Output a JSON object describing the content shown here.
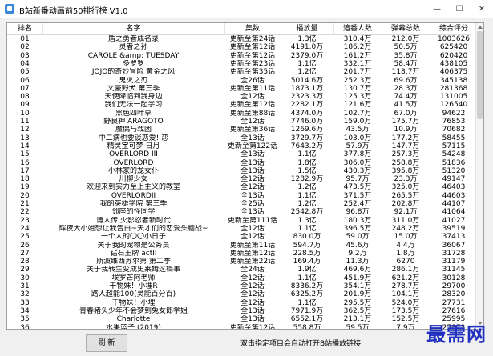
{
  "window": {
    "title": "B站新番动画前50排行榜 V1.0",
    "minimize": "—",
    "maximize": "☐",
    "close": "✕"
  },
  "table": {
    "headers": [
      "排名",
      "名字",
      "集数",
      "播放量",
      "追番人数",
      "弹幕总数",
      "综合评分"
    ],
    "rows": [
      [
        "01",
        "盾之勇者成名录",
        "更新至第24话",
        "1.3亿",
        "310.4万",
        "212.0万",
        "1003626"
      ],
      [
        "02",
        "灵者之孙",
        "更新至第12话",
        "4191.0万",
        "186.2万",
        "50.5万",
        "625420"
      ],
      [
        "03",
        "CAROLE &amp; TUESDAY",
        "更新至第12话",
        "2379.0万",
        "161.2万",
        "35.8万",
        "620420"
      ],
      [
        "04",
        "多罗罗",
        "更新至第23话",
        "1.1亿",
        "332.1万",
        "58.4万",
        "438105"
      ],
      [
        "05",
        "JOJO的奇妙冒险 黄金之风",
        "更新至第35话",
        "1.2亿",
        "201.7万",
        "118.7万",
        "406375"
      ],
      [
        "06",
        "鬼灭之刃",
        "全26话",
        "5014.6万",
        "252.3万",
        "69.6万",
        "345138"
      ],
      [
        "07",
        "文豪野犬 第三季",
        "更新至第11话",
        "1873.1万",
        "130.7万",
        "28.3万",
        "281368"
      ],
      [
        "08",
        "天使降临到我身边",
        "全12话",
        "2323.3万",
        "125.3万",
        "74.4万",
        "131005"
      ],
      [
        "09",
        "我们无法一起学习",
        "更新至第12话",
        "2282.1万",
        "121.6万",
        "41.5万",
        "126540"
      ],
      [
        "10",
        "黑色四叶草",
        "更新至第88话",
        "4374.0万",
        "102.7万",
        "67.0万",
        "94622"
      ],
      [
        "11",
        "野良神 ARAGOTO",
        "全12话",
        "7746.0万",
        "159.0万",
        "175.7万",
        "76853"
      ],
      [
        "12",
        "魔偶马戏团",
        "更新至第36话",
        "1269.6万",
        "43.5万",
        "10.9万",
        "70682"
      ],
      [
        "13",
        "中二病也要谈恋爱! 恋",
        "全13话",
        "3729.7万",
        "103.0万",
        "177.2万",
        "58455"
      ],
      [
        "14",
        "精灵宝可梦 日月",
        "更新至第122话",
        "7643.2万",
        "57.9万",
        "147.7万",
        "57115"
      ],
      [
        "15",
        "OVERLORD III",
        "全13话",
        "1.1亿",
        "377.8万",
        "257.3万",
        "54248"
      ],
      [
        "16",
        "OVERLORD",
        "全13话",
        "1.8亿",
        "306.0万",
        "258.8万",
        "51836"
      ],
      [
        "17",
        "小林家的龙女仆",
        "全13话",
        "1.5亿",
        "430.3万",
        "395.8万",
        "51320"
      ],
      [
        "18",
        "川柳少女",
        "全12话",
        "1282.9万",
        "95.7万",
        "23.3万",
        "49147"
      ],
      [
        "19",
        "欢迎来到实力至上主义的教室",
        "全12话",
        "1.2亿",
        "473.5万",
        "325.0万",
        "46403"
      ],
      [
        "20",
        "OVERLORDII",
        "全13话",
        "1.1亿",
        "371.5万",
        "265.5万",
        "44603"
      ],
      [
        "21",
        "我的英雄学院 第三季",
        "全25话",
        "1.2亿",
        "252.4万",
        "202.8万",
        "44107"
      ],
      [
        "22",
        "邻座的怪同学",
        "全13话",
        "2542.8万",
        "96.8万",
        "92.1万",
        "41064"
      ],
      [
        "23",
        "博人传 火影忍者新时代",
        "更新至第111话",
        "1.3亿",
        "180.3万",
        "311.0万",
        "41027"
      ],
      [
        "24",
        "辉夜大小姐想让我告白~天才们的恋爱头脑战~",
        "全12话",
        "1.1亿",
        "396.5万",
        "248.2万",
        "39519"
      ],
      [
        "25",
        "一个人的〇〇小日子",
        "全12话",
        "830.0万",
        "59.0万",
        "15.0万",
        "37413"
      ],
      [
        "26",
        "关于我的宠物是公务员",
        "更新至第11话",
        "594.7万",
        "45.6万",
        "4.4万",
        "36067"
      ],
      [
        "27",
        "钻石王牌 actII",
        "更新至第12话",
        "228.5万",
        "9.2万",
        "1.8万",
        "31728"
      ],
      [
        "28",
        "斯波维西苏尔第 第二季",
        "更新至第22话",
        "169.4万",
        "11.3万",
        "6270",
        "31179"
      ],
      [
        "29",
        "关于我转生变成史莱姆这档事",
        "全24话",
        "1.9亿",
        "469.6万",
        "286.1万",
        "31145"
      ],
      [
        "30",
        "埃罗芒阿老师",
        "全12话",
        "1.1亿",
        "451.9万",
        "621.2万",
        "30128"
      ],
      [
        "31",
        "干物妹！小埋R",
        "全12话",
        "8336.2万",
        "354.1万",
        "278.7万",
        "29700"
      ],
      [
        "32",
        "路人超能100(灵能百分百)",
        "全12话",
        "6325.2万",
        "201.9万",
        "104.1万",
        "28320"
      ],
      [
        "33",
        "干物妹！小埋",
        "全12话",
        "1.1亿",
        "295.5万",
        "524.0万",
        "27731"
      ],
      [
        "34",
        "青春猪头少年不会梦到兔女郎学姐",
        "全13话",
        "7971.9万",
        "362.5万",
        "173.5万",
        "27616"
      ],
      [
        "35",
        "Charlotte",
        "全13话",
        "6552.1万",
        "213.1万",
        "152.5万",
        "25995"
      ],
      [
        "36",
        "水果篮子 (2019)",
        "更新至第12话",
        "558.8万",
        "59.5万",
        "7.9万",
        "25873"
      ]
    ]
  },
  "bottom": {
    "refresh_label": "刷 新",
    "hint": "双击指定项目会自动打开B站播放链接"
  },
  "watermark": "最需网"
}
